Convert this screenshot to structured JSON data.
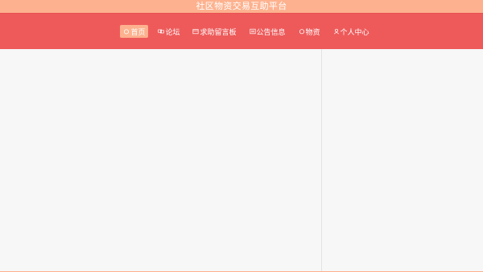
{
  "header": {
    "title": "社区物资交易互助平台"
  },
  "nav": {
    "items": [
      {
        "label": "首页",
        "icon": "home-icon",
        "active": true
      },
      {
        "label": "论坛",
        "icon": "forum-icon",
        "active": false
      },
      {
        "label": "求助留言板",
        "icon": "message-board-icon",
        "active": false
      },
      {
        "label": "公告信息",
        "icon": "notice-icon",
        "active": false
      },
      {
        "label": "物资",
        "icon": "goods-icon",
        "active": false
      },
      {
        "label": "个人中心",
        "icon": "user-icon",
        "active": false
      }
    ]
  },
  "colors": {
    "title_bar": "#fdb18e",
    "nav_bar": "#ee5a5a",
    "active_item": "#fdb18e",
    "background": "#f7f7f7"
  }
}
